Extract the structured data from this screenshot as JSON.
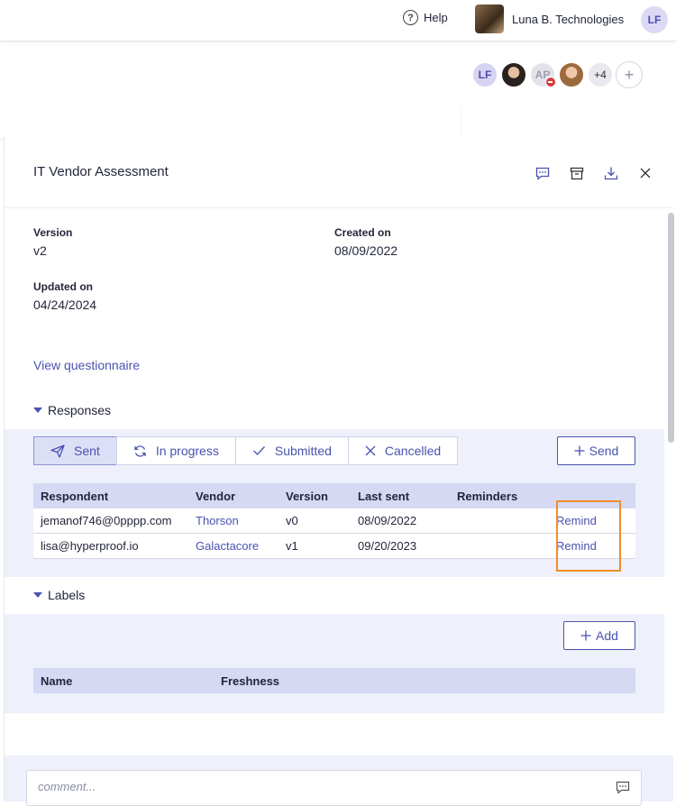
{
  "topbar": {
    "help_label": "Help",
    "org_name": "Luna B. Technologies",
    "user_initials": "LF"
  },
  "collaborators": {
    "first_initials": "LF",
    "third_initials": "AP",
    "more_count": "+4",
    "add_symbol": "+"
  },
  "panel": {
    "title": "IT Vendor Assessment",
    "icons": [
      "comment-icon",
      "archive-icon",
      "download-icon",
      "close-icon"
    ]
  },
  "details": {
    "version_label": "Version",
    "version_value": "v2",
    "created_label": "Created on",
    "created_value": "08/09/2022",
    "updated_label": "Updated on",
    "updated_value": "04/24/2024",
    "view_link": "View questionnaire"
  },
  "responses": {
    "heading": "Responses",
    "tabs": [
      {
        "label": "Sent",
        "icon": "paper-plane-icon",
        "active": true
      },
      {
        "label": "In progress",
        "icon": "refresh-icon",
        "active": false
      },
      {
        "label": "Submitted",
        "icon": "check-icon",
        "active": false
      },
      {
        "label": "Cancelled",
        "icon": "x-icon",
        "active": false
      }
    ],
    "send_label": "Send",
    "columns": [
      "Respondent",
      "Vendor",
      "Version",
      "Last sent",
      "Reminders"
    ],
    "rows": [
      {
        "respondent": "jemanof746@0pppp.com",
        "vendor": "Thorson",
        "version": "v0",
        "last_sent": "08/09/2022",
        "reminders": "",
        "action": "Remind"
      },
      {
        "respondent": "lisa@hyperproof.io",
        "vendor": "Galactacore",
        "version": "v1",
        "last_sent": "09/20/2023",
        "reminders": "",
        "action": "Remind"
      }
    ]
  },
  "labels": {
    "heading": "Labels",
    "add_label": "Add",
    "columns": [
      "Name",
      "Freshness"
    ]
  },
  "comment": {
    "placeholder": "comment..."
  },
  "colors": {
    "accent": "#4a52b0",
    "highlight": "#f28c2b",
    "section_bg": "#eef0fb",
    "table_header": "#d6d9f4"
  }
}
